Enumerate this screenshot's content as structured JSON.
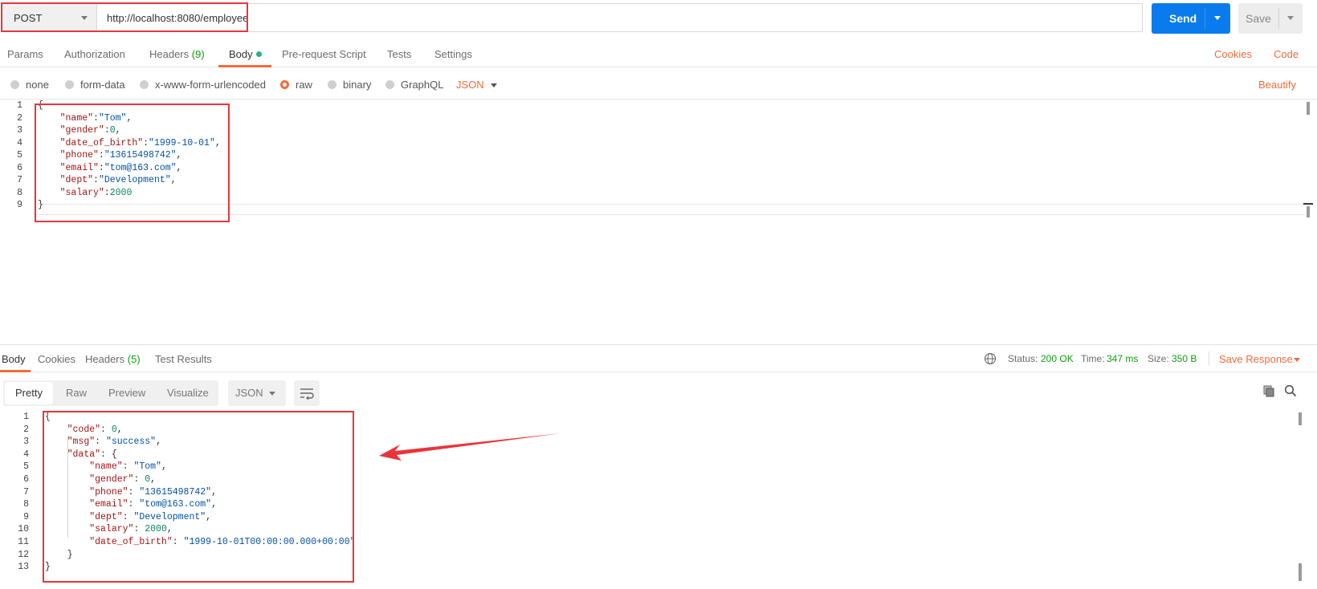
{
  "request": {
    "method": "POST",
    "url": "http://localhost:8080/employee",
    "send_label": "Send",
    "save_label": "Save"
  },
  "request_tabs": {
    "params": "Params",
    "authorization": "Authorization",
    "headers": "Headers",
    "headers_count": "(9)",
    "body": "Body",
    "pre_request_script": "Pre-request Script",
    "tests": "Tests",
    "settings": "Settings",
    "cookies": "Cookies",
    "code": "Code"
  },
  "body_types": {
    "none": "none",
    "form_data": "form-data",
    "urlencoded": "x-www-form-urlencoded",
    "raw": "raw",
    "binary": "binary",
    "graphql": "GraphQL",
    "format": "JSON",
    "beautify": "Beautify",
    "selected": "raw"
  },
  "request_body_lines": [
    "{",
    "    \"name\":\"Tom\",",
    "    \"gender\":0,",
    "    \"date_of_birth\":\"1999-10-01\",",
    "    \"phone\":\"13615498742\",",
    "    \"email\":\"tom@163.com\",",
    "    \"dept\":\"Development\",",
    "    \"salary\":2000",
    "}"
  ],
  "response_tabs": {
    "body": "Body",
    "cookies": "Cookies",
    "headers": "Headers",
    "headers_count": "(5)",
    "test_results": "Test Results"
  },
  "response_status": {
    "status_label": "Status:",
    "status_value": "200 OK",
    "time_label": "Time:",
    "time_value": "347 ms",
    "size_label": "Size:",
    "size_value": "350 B",
    "save_response": "Save Response"
  },
  "view_tabs": {
    "pretty": "Pretty",
    "raw": "Raw",
    "preview": "Preview",
    "visualize": "Visualize",
    "format": "JSON"
  },
  "response_body_lines": [
    "{",
    "    \"code\": 0,",
    "    \"msg\": \"success\",",
    "    \"data\": {",
    "        \"name\": \"Tom\",",
    "        \"gender\": 0,",
    "        \"phone\": \"13615498742\",",
    "        \"email\": \"tom@163.com\",",
    "        \"dept\": \"Development\",",
    "        \"salary\": 2000,",
    "        \"date_of_birth\": \"1999-10-01T00:00:00.000+00:00\"",
    "    }",
    "}"
  ],
  "colors": {
    "accent_orange": "#f26b3a",
    "send_blue": "#097bed",
    "highlight_red": "#e8353b",
    "success_green": "#0ca10c"
  }
}
